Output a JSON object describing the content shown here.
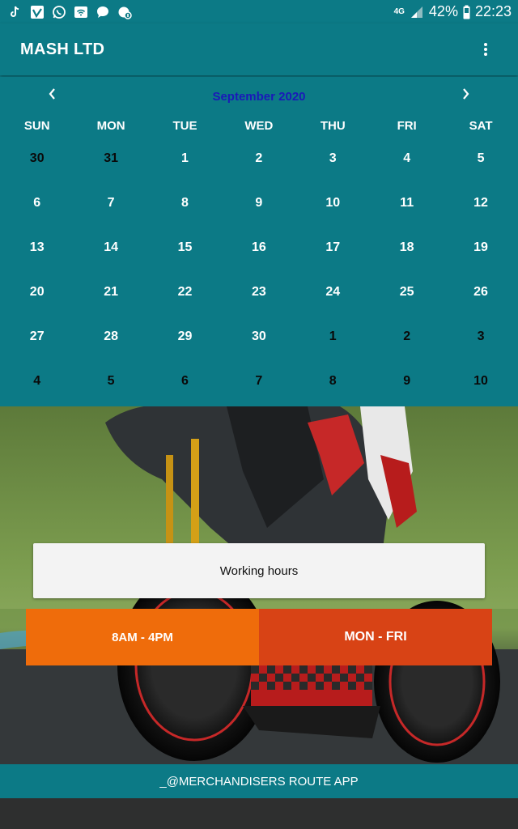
{
  "status_bar": {
    "network": "4G",
    "battery": "42%",
    "time": "22:23",
    "left_icons": [
      "tiktok-icon",
      "vimeo-icon",
      "whatsapp-icon",
      "wifi-hotspot-icon",
      "chat-bubble-icon",
      "notification-settings-icon"
    ]
  },
  "app_bar": {
    "title": "MASH LTD",
    "menu_icon": "overflow-menu-icon"
  },
  "calendar": {
    "month_label": "September 2020",
    "weekdays": [
      "SUN",
      "MON",
      "TUE",
      "WED",
      "THU",
      "FRI",
      "SAT"
    ],
    "days": [
      {
        "label": "30",
        "current": false
      },
      {
        "label": "31",
        "current": false
      },
      {
        "label": "1",
        "current": true
      },
      {
        "label": "2",
        "current": true
      },
      {
        "label": "3",
        "current": true
      },
      {
        "label": "4",
        "current": true
      },
      {
        "label": "5",
        "current": true
      },
      {
        "label": "6",
        "current": true
      },
      {
        "label": "7",
        "current": true
      },
      {
        "label": "8",
        "current": true
      },
      {
        "label": "9",
        "current": true
      },
      {
        "label": "10",
        "current": true
      },
      {
        "label": "11",
        "current": true
      },
      {
        "label": "12",
        "current": true
      },
      {
        "label": "13",
        "current": true
      },
      {
        "label": "14",
        "current": true
      },
      {
        "label": "15",
        "current": true
      },
      {
        "label": "16",
        "current": true
      },
      {
        "label": "17",
        "current": true
      },
      {
        "label": "18",
        "current": true
      },
      {
        "label": "19",
        "current": true
      },
      {
        "label": "20",
        "current": true
      },
      {
        "label": "21",
        "current": true
      },
      {
        "label": "22",
        "current": true
      },
      {
        "label": "23",
        "current": true
      },
      {
        "label": "24",
        "current": true
      },
      {
        "label": "25",
        "current": true
      },
      {
        "label": "26",
        "current": true
      },
      {
        "label": "27",
        "current": true
      },
      {
        "label": "28",
        "current": true
      },
      {
        "label": "29",
        "current": true
      },
      {
        "label": "30",
        "current": true
      },
      {
        "label": "1",
        "current": false
      },
      {
        "label": "2",
        "current": false
      },
      {
        "label": "3",
        "current": false
      },
      {
        "label": "4",
        "current": false
      },
      {
        "label": "5",
        "current": false
      },
      {
        "label": "6",
        "current": false
      },
      {
        "label": "7",
        "current": false
      },
      {
        "label": "8",
        "current": false
      },
      {
        "label": "9",
        "current": false
      },
      {
        "label": "10",
        "current": false
      }
    ]
  },
  "working_hours": {
    "label": "Working hours",
    "time_button": "8AM - 4PM",
    "days_button": "MON - FRI"
  },
  "footer": {
    "text": "_@MERCHANDISERS ROUTE APP"
  },
  "colors": {
    "primary": "#0c7a86",
    "month_label": "#1a1ab8",
    "time_button": "#ef6c0b",
    "days_button": "#d84315"
  }
}
